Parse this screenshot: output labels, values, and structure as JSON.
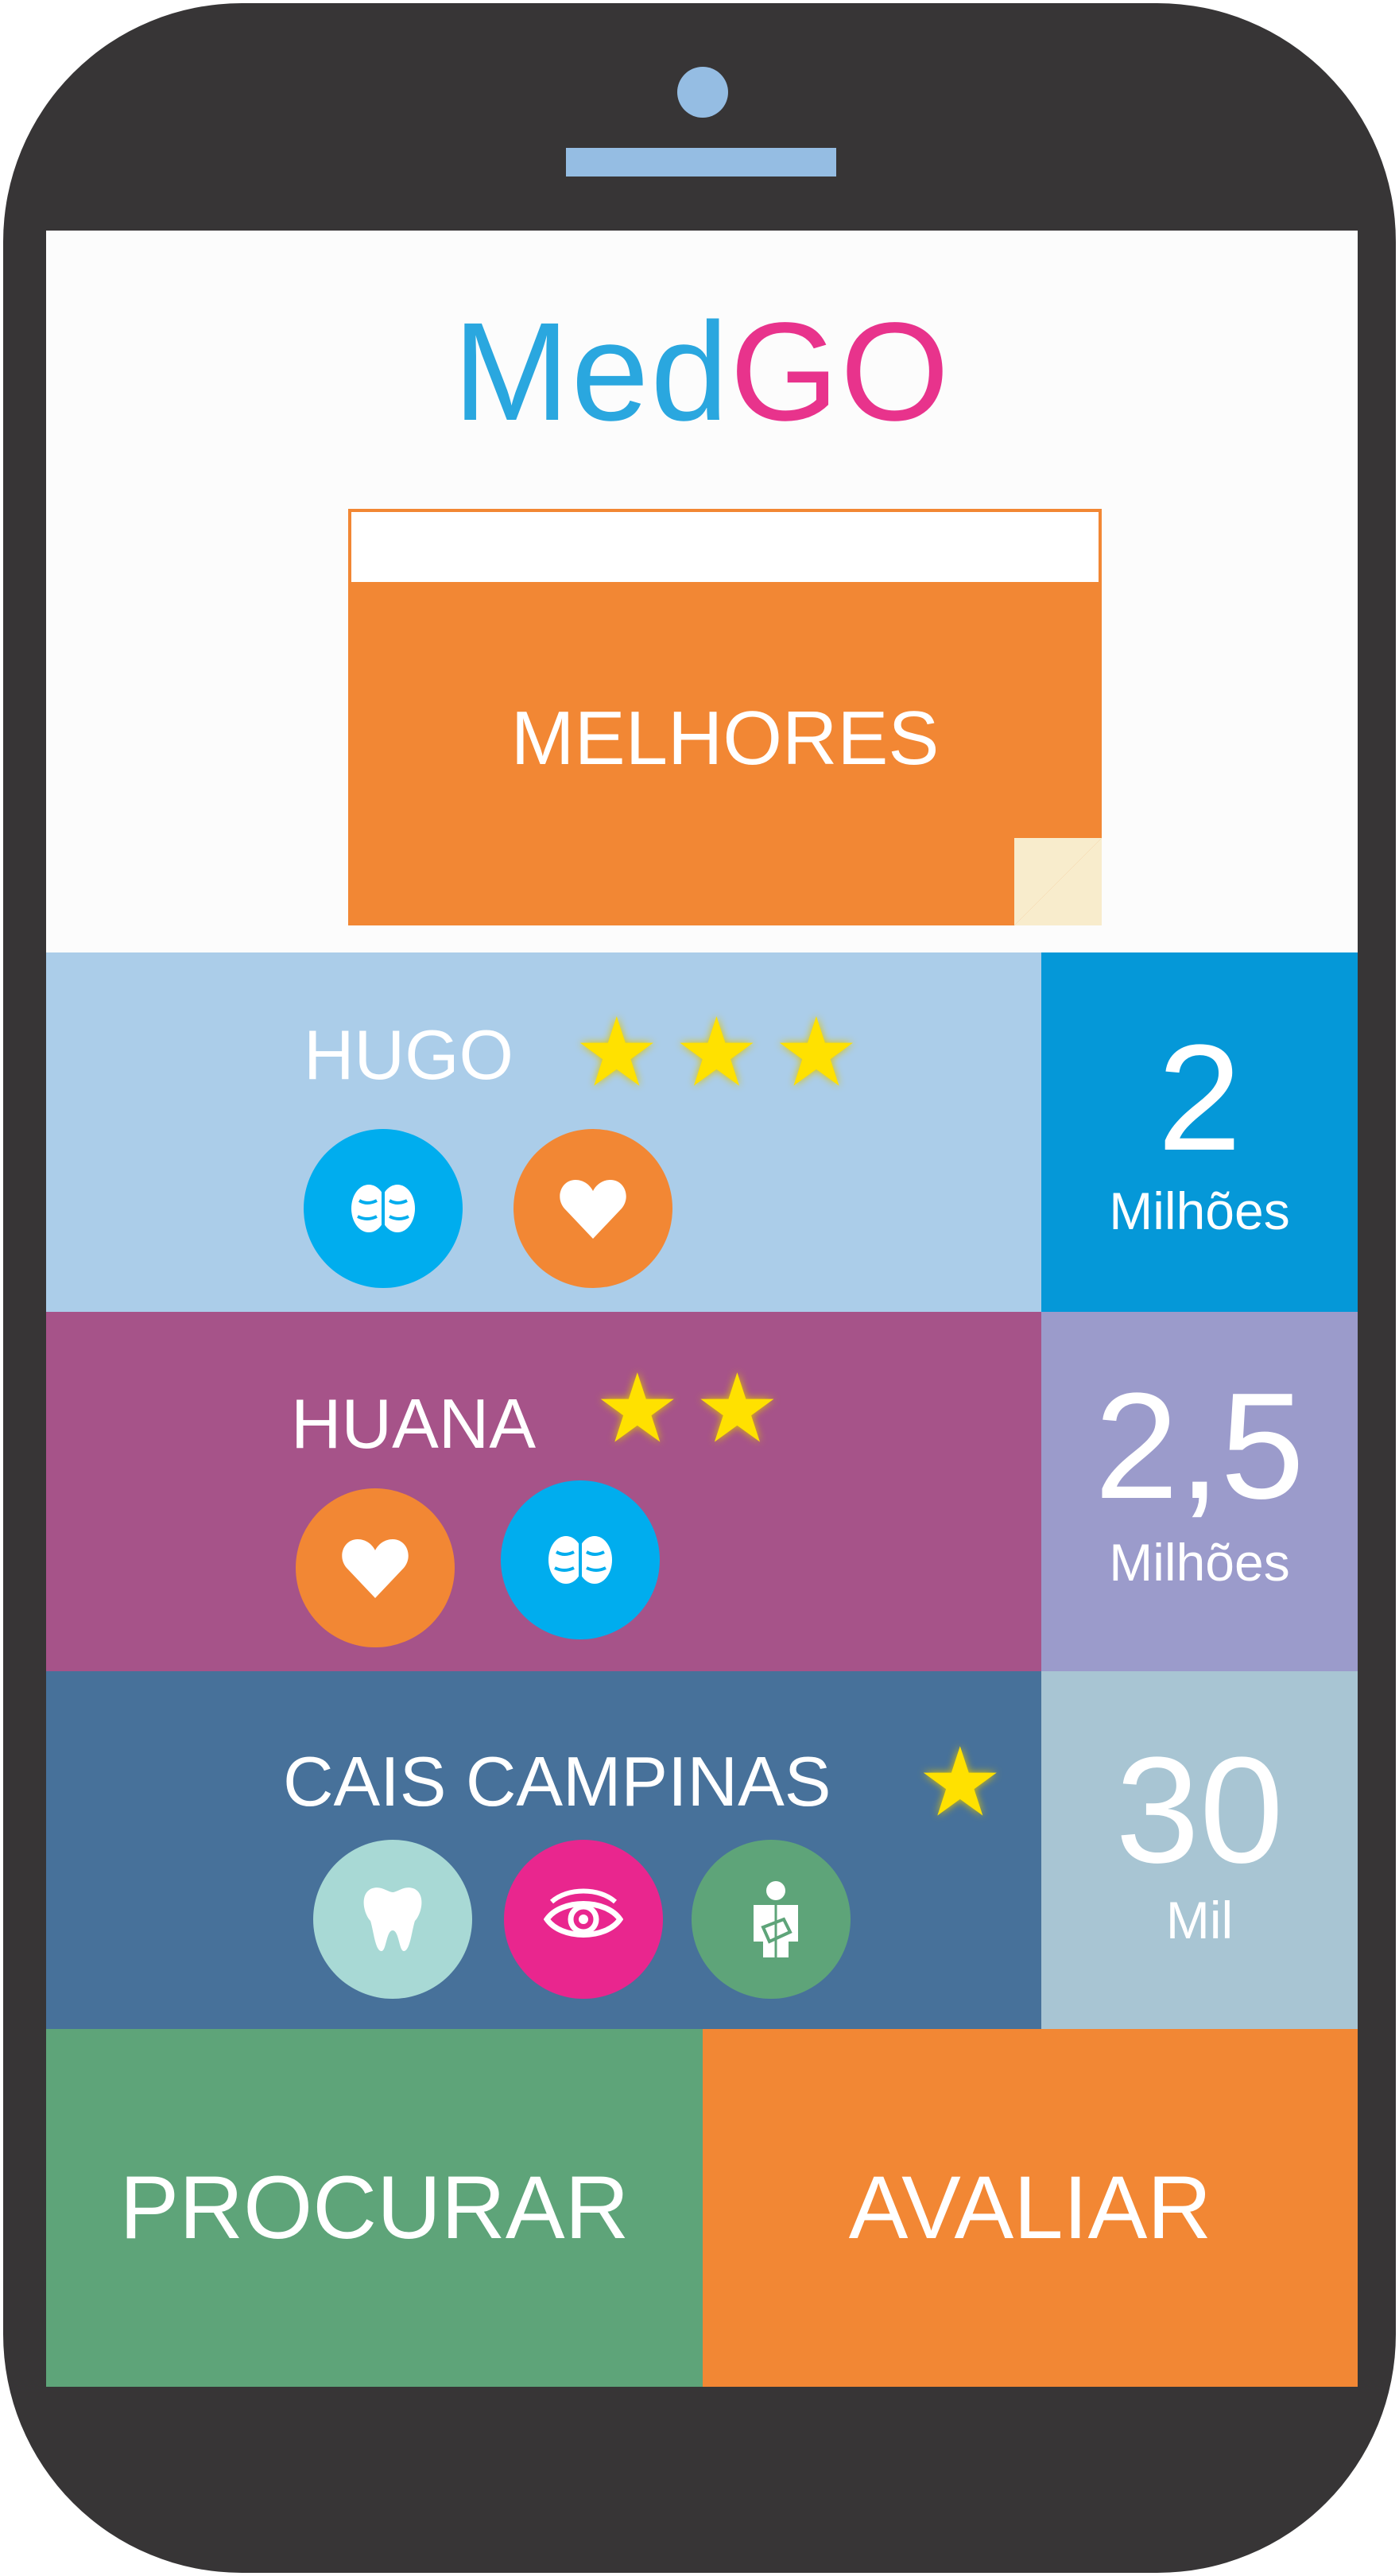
{
  "app": {
    "logo_part1": "Med",
    "logo_part2": "GO"
  },
  "banner": {
    "label": "MELHORES"
  },
  "ranking": [
    {
      "name": "HUGO",
      "stars": "★★★",
      "value": "2",
      "unit": "Milhões",
      "icons": [
        "brain-icon",
        "heart-icon"
      ]
    },
    {
      "name": "HUANA",
      "stars": "★★",
      "value": "2,5",
      "unit": "Milhões",
      "icons": [
        "heart-icon",
        "brain-icon"
      ]
    },
    {
      "name": "CAIS CAMPINAS",
      "stars": "★",
      "value": "30",
      "unit": "Mil",
      "icons": [
        "tooth-icon",
        "eye-icon",
        "injured-person-icon"
      ]
    }
  ],
  "actions": {
    "search": "PROCURAR",
    "rate": "AVALIAR"
  },
  "colors": {
    "phone": "#373536",
    "accent_orange": "#f28734",
    "green": "#5ea479",
    "row1": "#abcde9",
    "row1_side": "#0598d8",
    "row2": "#a65389",
    "row2_side": "#9b9bcb",
    "row3": "#47719a",
    "row3_side": "#a8c5d3",
    "brain_bubble": "#00adee",
    "eye_bubble": "#e9268e",
    "tooth_bubble": "#a8d9d5"
  }
}
